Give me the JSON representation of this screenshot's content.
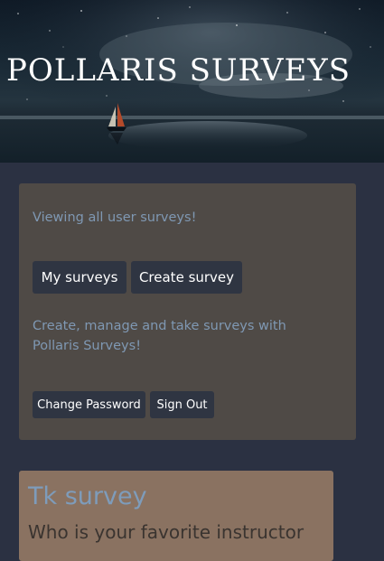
{
  "header": {
    "brand": "POLLARIS SURVEYS"
  },
  "panel": {
    "status_text": "Viewing all user surveys!",
    "buttons": {
      "my_surveys": "My surveys",
      "create_survey": "Create survey"
    },
    "tagline": "Create, manage and take surveys with Pollaris Surveys!",
    "account_buttons": {
      "change_password": "Change Password",
      "sign_out": "Sign Out"
    }
  },
  "surveys": [
    {
      "title": "Tk survey",
      "question": "Who is your favorite instructor"
    }
  ],
  "colors": {
    "page_bg": "#2b3142",
    "panel_bg": "#4f4a46",
    "button_bg": "#2f3542",
    "accent_text": "#7f98b3",
    "card_bg": "#8a7261"
  },
  "icons": {
    "hero": "night-sky-sailboat-image"
  }
}
